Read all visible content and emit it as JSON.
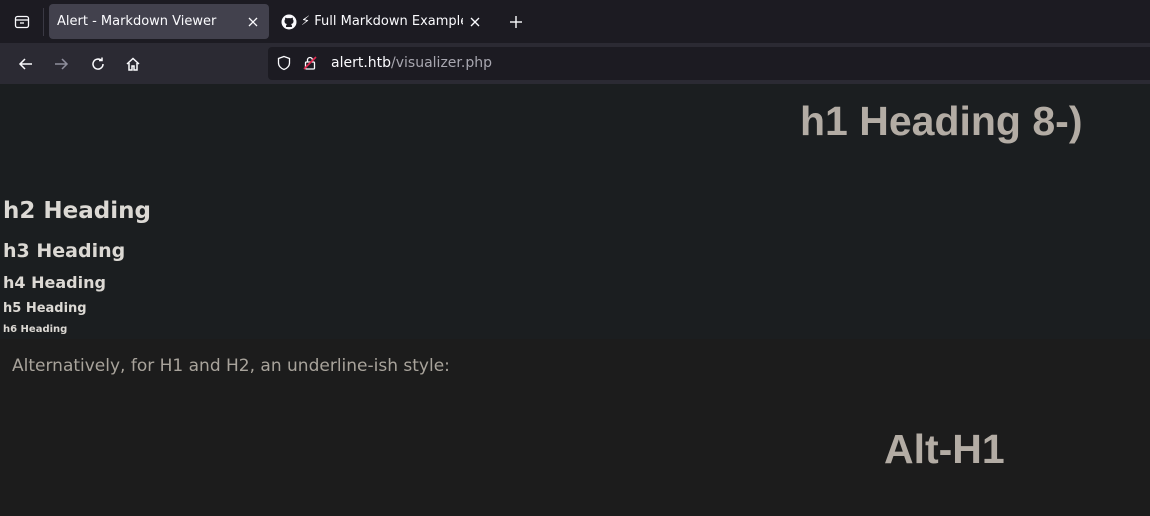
{
  "browser": {
    "tabs": [
      {
        "title": "Alert - Markdown Viewer",
        "active": true
      },
      {
        "title": "⚡ Full Markdown Example",
        "active": false,
        "favicon": "github-icon"
      }
    ],
    "url": {
      "domain": "alert.htb",
      "path": "/visualizer.php"
    }
  },
  "page": {
    "h1": "h1 Heading 8-)",
    "h2": "h2 Heading",
    "h3": "h3 Heading",
    "h4": "h4 Heading",
    "h5": "h5 Heading",
    "h6": "h6 Heading",
    "paragraph": "Alternatively, for H1 and H2, an underline-ish style:",
    "alt_h1": "Alt-H1"
  }
}
